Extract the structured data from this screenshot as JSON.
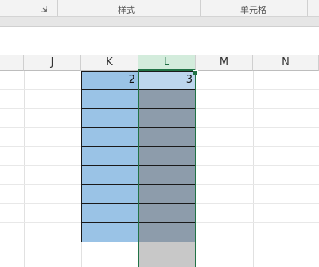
{
  "ribbon": {
    "styles_label": "样式",
    "cells_label": "单元格"
  },
  "icons": {
    "dialog_launcher": "dialog-launcher-icon"
  },
  "columns": [
    {
      "label": "J"
    },
    {
      "label": "K"
    },
    {
      "label": "L"
    },
    {
      "label": "M"
    },
    {
      "label": "N"
    }
  ],
  "selected_column": "L",
  "cells": {
    "K_first": "2",
    "L_first": "3"
  },
  "colors": {
    "accent_green": "#217346",
    "k_fill": "#9ac3e6",
    "l_fill": "#8d9cab",
    "l_selected_fill": "#bcd6ee"
  }
}
